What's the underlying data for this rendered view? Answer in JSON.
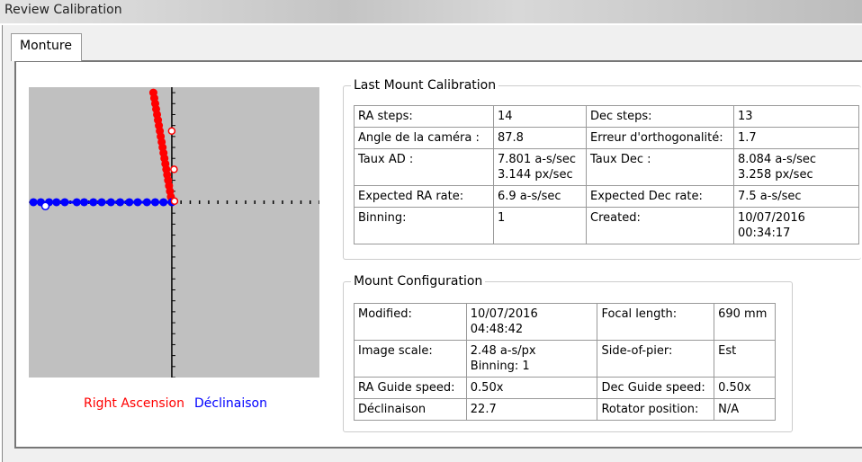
{
  "window": {
    "title": "Review Calibration"
  },
  "tabs": [
    {
      "label": "Monture"
    }
  ],
  "chart_data": {
    "type": "scatter",
    "series": [
      {
        "name": "Right Ascension",
        "color": "#ff0000",
        "x": [
          0,
          -0.1,
          -0.2,
          -0.3,
          -0.4,
          -0.5,
          -0.6,
          -0.7,
          -0.8,
          -0.9,
          -1.0,
          -1.1,
          -1.2,
          -1.3,
          -1.4,
          -1.5,
          -1.6,
          -1.7,
          -1.8,
          -1.9,
          -2.0
        ],
        "y": [
          0,
          0.5,
          1,
          1.5,
          2,
          2.5,
          3,
          3.5,
          4,
          4.5,
          5,
          5.5,
          6,
          6.5,
          7,
          7.5,
          8,
          8.5,
          9,
          9.5,
          10
        ]
      },
      {
        "name": "Déclinaison",
        "color": "#0000ff",
        "x": [
          0,
          -0.9,
          -1.8,
          -2.7,
          -3.7,
          -4.6,
          -5.6,
          -6.6,
          -7.6,
          -8.5,
          -9.5,
          -10.3,
          -11.6,
          -12.5,
          -13.3,
          -14.2,
          -15
        ],
        "y": [
          0,
          0,
          0,
          0,
          0,
          0,
          0,
          0,
          0,
          0,
          0,
          0,
          0,
          0,
          0,
          0,
          0
        ]
      }
    ],
    "xlim": [
      -15.5,
      16
    ],
    "ylim": [
      -16,
      10.5
    ]
  },
  "legend": {
    "ra": "Right Ascension",
    "dec": "Déclinaison"
  },
  "last_calibration": {
    "title": "Last Mount Calibration",
    "rows": [
      [
        "RA steps:",
        "14",
        "Dec steps:",
        "13"
      ],
      [
        "Angle de la caméra :",
        "87.8",
        "Erreur d'orthogonalité:",
        "1.7"
      ],
      [
        "Taux AD :",
        "7.801 a-s/sec\n3.144 px/sec",
        "Taux Dec :",
        "8.084 a-s/sec\n3.258 px/sec"
      ],
      [
        "Expected RA rate:",
        "6.9 a-s/sec",
        "Expected Dec rate:",
        "7.5 a-s/sec"
      ],
      [
        "Binning:",
        "1",
        "Created:",
        "10/07/2016 00:34:17"
      ]
    ]
  },
  "mount_config": {
    "title": "Mount Configuration",
    "rows": [
      [
        "Modified:",
        "10/07/2016 04:48:42",
        "Focal length:",
        "690 mm"
      ],
      [
        "Image scale:",
        "2.48 a-s/px\nBinning: 1",
        "Side-of-pier:",
        "Est"
      ],
      [
        "RA Guide speed:",
        "0.50x",
        "Dec Guide speed:",
        "0.50x"
      ],
      [
        "Déclinaison",
        "22.7",
        "Rotator position:",
        "N/A"
      ]
    ]
  }
}
